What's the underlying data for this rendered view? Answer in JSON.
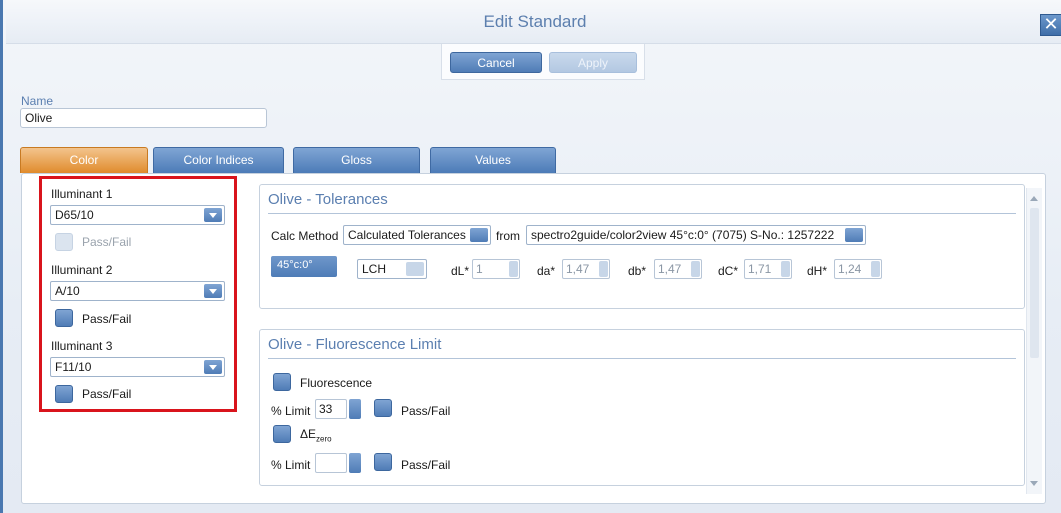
{
  "window": {
    "title": "Edit Standard",
    "close_glyph": "✕"
  },
  "actions": {
    "cancel_label": "Cancel",
    "apply_label": "Apply"
  },
  "name": {
    "label": "Name",
    "value": "Olive"
  },
  "tabs": [
    {
      "label": "Color",
      "active": true
    },
    {
      "label": "Color Indices",
      "active": false
    },
    {
      "label": "Gloss",
      "active": false
    },
    {
      "label": "Values",
      "active": false
    }
  ],
  "illuminants": [
    {
      "label": "Illuminant 1",
      "value": "D65/10",
      "passfail_label": "Pass/Fail",
      "passfail_enabled": false
    },
    {
      "label": "Illuminant 2",
      "value": "A/10",
      "passfail_label": "Pass/Fail",
      "passfail_enabled": true
    },
    {
      "label": "Illuminant 3",
      "value": "F11/10",
      "passfail_label": "Pass/Fail",
      "passfail_enabled": true
    }
  ],
  "tolerances": {
    "title": "Olive - Tolerances",
    "calc_method_label": "Calc Method",
    "calc_method_value": "Calculated Tolerances",
    "from_label": "from",
    "source_value": "spectro2guide/color2view 45°c:0° (7075)   S-No.: 1257222",
    "angle": "45°c:0°",
    "space": "LCH",
    "fields": [
      {
        "label": "dL*",
        "value": "1"
      },
      {
        "label": "da*",
        "value": "1,47"
      },
      {
        "label": "db*",
        "value": "1,47"
      },
      {
        "label": "dC*",
        "value": "1,71"
      },
      {
        "label": "dH*",
        "value": "1,24"
      }
    ]
  },
  "fluorescence": {
    "title": "Olive - Fluorescence Limit",
    "fluorescence_label": "Fluorescence",
    "limit_label": "% Limit",
    "limit_value": "33",
    "passfail_label": "Pass/Fail",
    "ezero_label": "ΔE",
    "ezero_sub": "zero",
    "limit2_label": "% Limit",
    "limit2_value": "",
    "passfail2_label": "Pass/Fail"
  },
  "colors": {
    "accent": "#4f7cb6",
    "active_tab": "#e08b2c",
    "highlight_border": "#d9141c",
    "title_text": "#5b7fb0"
  }
}
